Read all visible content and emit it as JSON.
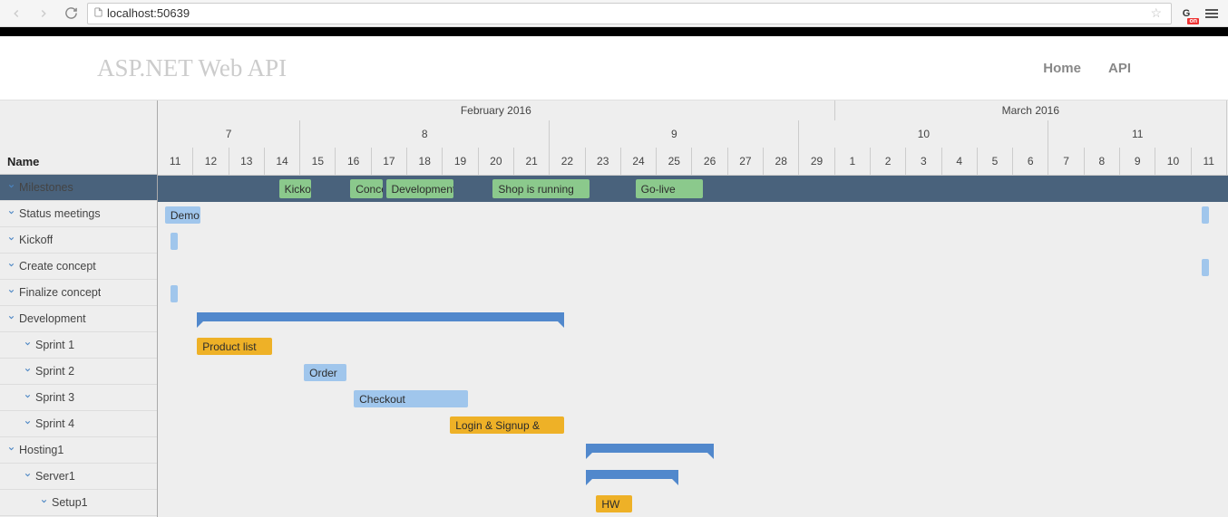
{
  "browser": {
    "url": "localhost:50639"
  },
  "header": {
    "brand": "ASP.NET Web API",
    "nav": [
      {
        "label": "Home",
        "name": "nav-home"
      },
      {
        "label": "API",
        "name": "nav-api"
      }
    ]
  },
  "gantt": {
    "nameColumn": "Name",
    "dayWidthPx": 39.3,
    "months": [
      {
        "label": "February 2016",
        "days": 19
      },
      {
        "label": "March 2016",
        "days": 11
      }
    ],
    "weeks": [
      {
        "label": "7",
        "days": 4
      },
      {
        "label": "8",
        "days": 7
      },
      {
        "label": "9",
        "days": 7
      },
      {
        "label": "10",
        "days": 7
      },
      {
        "label": "11",
        "days": 5
      }
    ],
    "days": [
      "11",
      "12",
      "13",
      "14",
      "15",
      "16",
      "17",
      "18",
      "19",
      "20",
      "21",
      "22",
      "23",
      "24",
      "25",
      "26",
      "27",
      "28",
      "29",
      "1",
      "2",
      "3",
      "4",
      "5",
      "6",
      "7",
      "8",
      "9",
      "10",
      "11"
    ],
    "rows": [
      {
        "name": "Milestones",
        "type": "milestone-row",
        "indent": 0,
        "expander": true,
        "milestones": [
          {
            "label": "Kickoff",
            "startDay": 3.4,
            "widthDays": 0.9
          },
          {
            "label": "Concept",
            "startDay": 5.4,
            "widthDays": 0.9
          },
          {
            "label": "Development",
            "startDay": 6.4,
            "widthDays": 1.9
          },
          {
            "label": "Shop is running",
            "startDay": 9.4,
            "widthDays": 2.7
          },
          {
            "label": "Go-live",
            "startDay": 13.4,
            "widthDays": 1.9
          }
        ]
      },
      {
        "name": "Status meetings",
        "indent": 0,
        "expander": true,
        "bars": [
          {
            "class": "task-blue",
            "label": "Demo",
            "startDay": 0.2,
            "widthDays": 1.0
          },
          {
            "class": "task-blue task-tiny",
            "label": "",
            "startDay": 29.3,
            "widthDays": 0.2
          }
        ]
      },
      {
        "name": "Kickoff",
        "indent": 0,
        "expander": true,
        "bars": [
          {
            "class": "task-blue task-tiny",
            "label": "",
            "startDay": 0.35,
            "widthDays": 0.2
          }
        ]
      },
      {
        "name": "Create concept",
        "indent": 0,
        "expander": true,
        "bars": [
          {
            "class": "task-blue task-tiny",
            "label": "",
            "startDay": 29.3,
            "widthDays": 0.2
          }
        ]
      },
      {
        "name": "Finalize concept",
        "indent": 0,
        "expander": true,
        "bars": [
          {
            "class": "task-blue task-tiny",
            "label": "",
            "startDay": 0.35,
            "widthDays": 0.2
          }
        ]
      },
      {
        "name": "Development",
        "indent": 0,
        "expander": true,
        "group": {
          "startDay": 1.1,
          "widthDays": 10.3
        }
      },
      {
        "name": "Sprint 1",
        "indent": 1,
        "expander": true,
        "bars": [
          {
            "class": "task-yellow",
            "label": "Product list",
            "startDay": 1.1,
            "widthDays": 2.1
          }
        ]
      },
      {
        "name": "Sprint 2",
        "indent": 1,
        "expander": true,
        "bars": [
          {
            "class": "task-blue",
            "label": "Order",
            "startDay": 4.1,
            "widthDays": 1.2
          }
        ]
      },
      {
        "name": "Sprint 3",
        "indent": 1,
        "expander": true,
        "bars": [
          {
            "class": "task-blue",
            "label": "Checkout",
            "startDay": 5.5,
            "widthDays": 3.2
          }
        ]
      },
      {
        "name": "Sprint 4",
        "indent": 1,
        "expander": true,
        "bars": [
          {
            "class": "task-yellow",
            "label": "Login & Signup &",
            "startDay": 8.2,
            "widthDays": 3.2
          }
        ]
      },
      {
        "name": "Hosting1",
        "indent": 0,
        "expander": true,
        "group": {
          "startDay": 12.0,
          "widthDays": 3.6
        }
      },
      {
        "name": "Server1",
        "indent": 1,
        "expander": true,
        "group": {
          "startDay": 12.0,
          "widthDays": 2.6
        }
      },
      {
        "name": "Setup1",
        "indent": 2,
        "expander": true,
        "bars": [
          {
            "class": "task-yellow",
            "label": "HW",
            "startDay": 12.3,
            "widthDays": 1.0
          }
        ]
      }
    ]
  }
}
